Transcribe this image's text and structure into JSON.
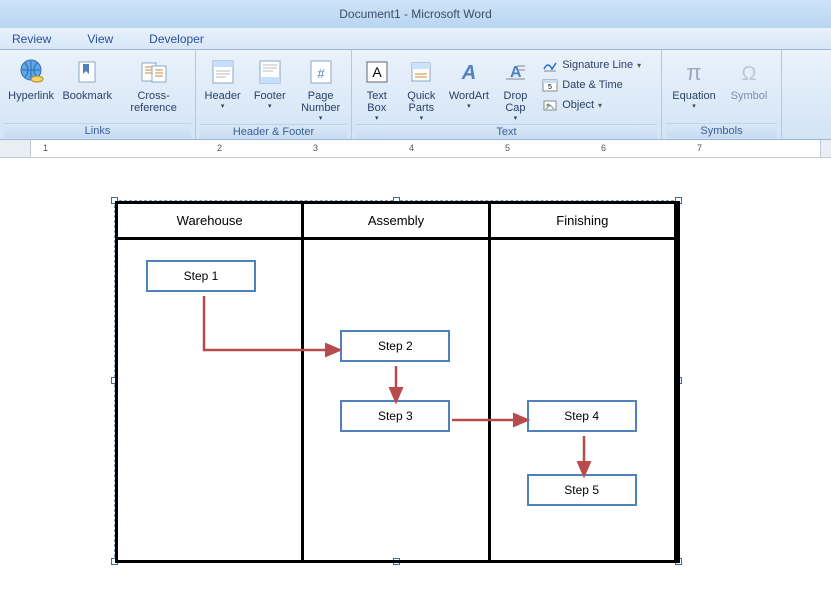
{
  "title": "Document1 - Microsoft Word",
  "tabs": {
    "review": "Review",
    "view": "View",
    "developer": "Developer"
  },
  "ribbon": {
    "links": {
      "label": "Links",
      "hyperlink": "Hyperlink",
      "bookmark": "Bookmark",
      "crossref": "Cross-reference"
    },
    "hf": {
      "label": "Header & Footer",
      "header": "Header",
      "footer": "Footer",
      "pagenum": "Page Number"
    },
    "text": {
      "label": "Text",
      "textbox": "Text Box",
      "quickparts": "Quick Parts",
      "wordart": "WordArt",
      "dropcap": "Drop Cap",
      "sig": "Signature Line",
      "datetime": "Date & Time",
      "object": "Object"
    },
    "symbols": {
      "label": "Symbols",
      "equation": "Equation",
      "symbol": "Symbol"
    }
  },
  "ruler": [
    "1",
    "2",
    "3",
    "4",
    "5",
    "6",
    "7"
  ],
  "lanes": [
    "Warehouse",
    "Assembly",
    "Finishing"
  ],
  "steps": {
    "s1": "Step 1",
    "s2": "Step 2",
    "s3": "Step 3",
    "s4": "Step 4",
    "s5": "Step 5"
  }
}
